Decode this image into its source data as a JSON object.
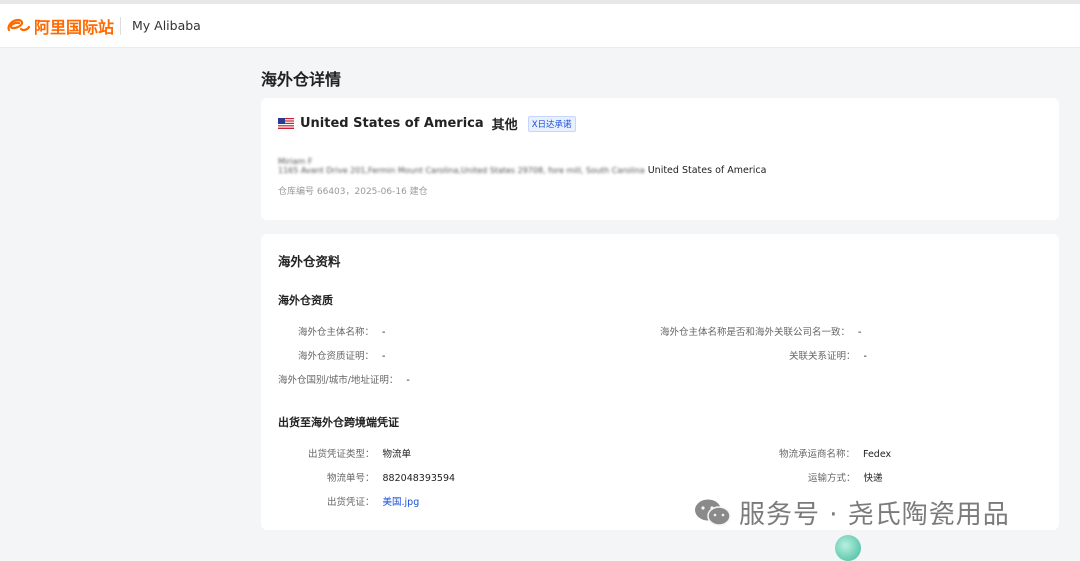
{
  "header": {
    "logo_text": "阿里国际站",
    "nav_label": "My Alibaba"
  },
  "page": {
    "title": "海外仓详情"
  },
  "warehouse": {
    "country": "United States of America",
    "type": "其他",
    "badge": "X日达承诺",
    "contact_name_blurred": "Miriam F",
    "address_blurred": "1165 Avant Drive 201,Fermin Mount Carolina,United States 29708, fore mill, South Carolina",
    "address_country": "United States of America",
    "meta": "仓库编号 66403，2025-06-16 建仓"
  },
  "info": {
    "section_title": "海外仓资料",
    "qualification": {
      "title": "海外仓资质",
      "fields": [
        {
          "label": "海外仓主体名称：",
          "value": "-"
        },
        {
          "label": "海外仓主体名称是否和海外关联公司名一致：",
          "value": "-"
        },
        {
          "label": "海外仓资质证明：",
          "value": "-"
        },
        {
          "label": "关联关系证明：",
          "value": "-"
        },
        {
          "label": "海外仓国别/城市/地址证明：",
          "value": "-"
        }
      ]
    },
    "shipping": {
      "title": "出货至海外仓跨境端凭证",
      "fields": [
        {
          "label": "出货凭证类型：",
          "value": "物流单"
        },
        {
          "label": "物流承运商名称：",
          "value": "Fedex"
        },
        {
          "label": "物流单号：",
          "value": "882048393594"
        },
        {
          "label": "运输方式：",
          "value": "快递"
        },
        {
          "label": "出货凭证：",
          "value": "美国.jpg"
        }
      ]
    }
  },
  "watermark": {
    "text": "服务号 · 尧氏陶瓷用品"
  },
  "colors": {
    "brand": "#ff6a00",
    "link": "#1a4fd6"
  }
}
